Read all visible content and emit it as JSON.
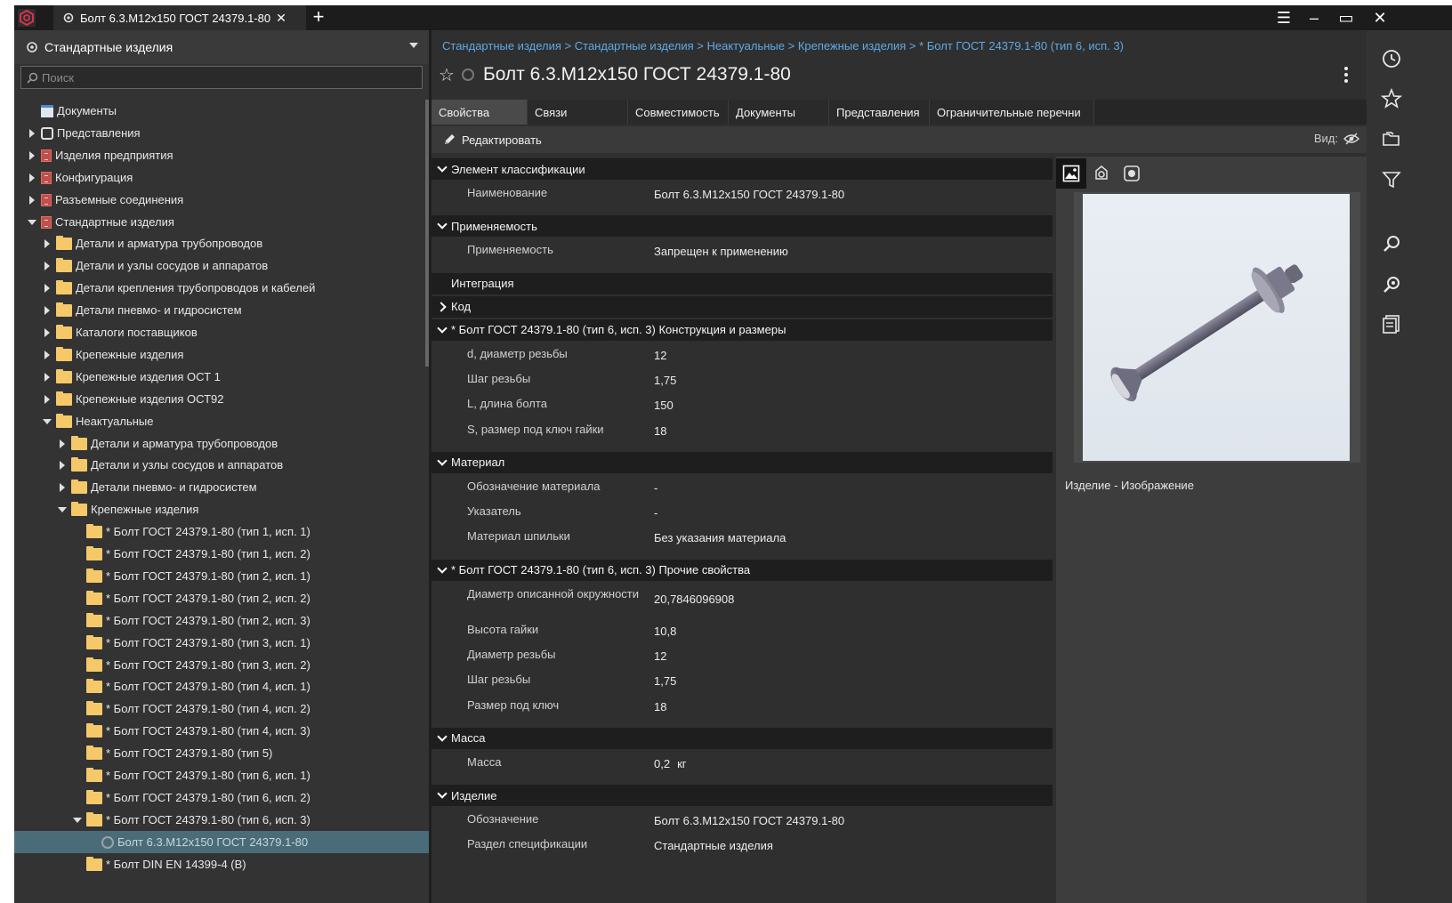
{
  "window": {
    "tab_title": "Болт 6.3.М12х150 ГОСТ 24379.1-80",
    "close_glyph": "✕",
    "new_tab_glyph": "+",
    "controls": {
      "menu": "☰",
      "minimize": "–",
      "maximize": "▭",
      "close": "✕"
    }
  },
  "left_panel": {
    "header_title": "Стандартные изделия",
    "search_placeholder": "Поиск",
    "tree": [
      {
        "label": "Документы",
        "level": 0,
        "expander": "none",
        "icon": "doc"
      },
      {
        "label": "Представления",
        "level": 0,
        "expander": "closed",
        "icon": "view"
      },
      {
        "label": "Изделия предприятия",
        "level": 0,
        "expander": "closed",
        "icon": "book"
      },
      {
        "label": "Конфигурация",
        "level": 0,
        "expander": "closed",
        "icon": "book"
      },
      {
        "label": "Разъемные соединения",
        "level": 0,
        "expander": "closed",
        "icon": "book"
      },
      {
        "label": "Стандартные изделия",
        "level": 0,
        "expander": "open",
        "icon": "book"
      },
      {
        "label": "Детали и арматура трубопроводов",
        "level": 1,
        "expander": "closed",
        "icon": "folder"
      },
      {
        "label": "Детали и узлы сосудов и аппаратов",
        "level": 1,
        "expander": "closed",
        "icon": "folder"
      },
      {
        "label": "Детали крепления трубопроводов и кабелей",
        "level": 1,
        "expander": "closed",
        "icon": "folder"
      },
      {
        "label": "Детали пневмо- и гидросистем",
        "level": 1,
        "expander": "closed",
        "icon": "folder"
      },
      {
        "label": "Каталоги поставщиков",
        "level": 1,
        "expander": "closed",
        "icon": "folder"
      },
      {
        "label": "Крепежные изделия",
        "level": 1,
        "expander": "closed",
        "icon": "folder"
      },
      {
        "label": "Крепежные изделия ОСТ 1",
        "level": 1,
        "expander": "closed",
        "icon": "folder"
      },
      {
        "label": "Крепежные изделия ОСТ92",
        "level": 1,
        "expander": "closed",
        "icon": "folder"
      },
      {
        "label": "Неактуальные",
        "level": 1,
        "expander": "open",
        "icon": "folder"
      },
      {
        "label": "Детали и арматура трубопроводов",
        "level": 2,
        "expander": "closed",
        "icon": "folder"
      },
      {
        "label": "Детали и узлы сосудов и аппаратов",
        "level": 2,
        "expander": "closed",
        "icon": "folder"
      },
      {
        "label": "Детали пневмо- и гидросистем",
        "level": 2,
        "expander": "closed",
        "icon": "folder"
      },
      {
        "label": "Крепежные изделия",
        "level": 2,
        "expander": "open",
        "icon": "folder"
      },
      {
        "label": "* Болт ГОСТ 24379.1-80 (тип 1, исп. 1)",
        "level": 3,
        "expander": "none",
        "icon": "folder"
      },
      {
        "label": "* Болт ГОСТ 24379.1-80 (тип 1, исп. 2)",
        "level": 3,
        "expander": "none",
        "icon": "folder"
      },
      {
        "label": "* Болт ГОСТ 24379.1-80 (тип 2, исп. 1)",
        "level": 3,
        "expander": "none",
        "icon": "folder"
      },
      {
        "label": "* Болт ГОСТ 24379.1-80 (тип 2, исп. 2)",
        "level": 3,
        "expander": "none",
        "icon": "folder"
      },
      {
        "label": "* Болт ГОСТ 24379.1-80 (тип 2, исп. 3)",
        "level": 3,
        "expander": "none",
        "icon": "folder"
      },
      {
        "label": "* Болт ГОСТ 24379.1-80 (тип 3, исп. 1)",
        "level": 3,
        "expander": "none",
        "icon": "folder"
      },
      {
        "label": "* Болт ГОСТ 24379.1-80 (тип 3, исп. 2)",
        "level": 3,
        "expander": "none",
        "icon": "folder"
      },
      {
        "label": "* Болт ГОСТ 24379.1-80 (тип 4, исп. 1)",
        "level": 3,
        "expander": "none",
        "icon": "folder"
      },
      {
        "label": "* Болт ГОСТ 24379.1-80 (тип 4, исп. 2)",
        "level": 3,
        "expander": "none",
        "icon": "folder"
      },
      {
        "label": "* Болт ГОСТ 24379.1-80 (тип 4, исп. 3)",
        "level": 3,
        "expander": "none",
        "icon": "folder"
      },
      {
        "label": "* Болт ГОСТ 24379.1-80 (тип 5)",
        "level": 3,
        "expander": "none",
        "icon": "folder"
      },
      {
        "label": "* Болт ГОСТ 24379.1-80 (тип 6, исп. 1)",
        "level": 3,
        "expander": "none",
        "icon": "folder"
      },
      {
        "label": "* Болт ГОСТ 24379.1-80 (тип 6, исп. 2)",
        "level": 3,
        "expander": "none",
        "icon": "folder"
      },
      {
        "label": "* Болт ГОСТ 24379.1-80 (тип 6, исп. 3)",
        "level": 3,
        "expander": "open",
        "icon": "folder"
      },
      {
        "label": "Болт 6.3.М12х150 ГОСТ 24379.1-80",
        "level": 4,
        "expander": "none",
        "icon": "gear",
        "selected": true
      },
      {
        "label": "* Болт DIN EN 14399-4 (B)",
        "level": 3,
        "expander": "none",
        "icon": "folder"
      }
    ]
  },
  "main": {
    "breadcrumb": [
      "Стандартные изделия",
      "Стандартные изделия",
      "Неактуальные",
      "Крепежные изделия",
      "* Болт ГОСТ 24379.1-80 (тип 6, исп. 3)"
    ],
    "breadcrumb_sep": ">",
    "star_glyph": "☆",
    "title": "Болт 6.3.М12х150 ГОСТ 24379.1-80",
    "tabs": [
      "Свойства",
      "Связи",
      "Совместимость",
      "Документы",
      "Представления",
      "Ограничительные перечни"
    ],
    "active_tab": 0,
    "edit_label": "Редактировать",
    "view_label": "Вид:",
    "sections": [
      {
        "title": "Элемент классификации",
        "state": "open",
        "rows": [
          {
            "key": "Наименование",
            "value": "Болт 6.3.М12х150 ГОСТ 24379.1-80"
          }
        ]
      },
      {
        "title": "Применяемость",
        "state": "open",
        "rows": [
          {
            "key": "Применяемость",
            "value": "Запрещен к применению"
          }
        ]
      },
      {
        "title": "Интеграция",
        "state": "plain",
        "rows": []
      },
      {
        "title": "Код",
        "state": "closed",
        "rows": []
      },
      {
        "title": "* Болт ГОСТ 24379.1-80 (тип 6, исп. 3) Конструкция и размеры",
        "state": "open",
        "rows": [
          {
            "key": "d, диаметр резьбы",
            "value": "12"
          },
          {
            "key": "Шаг резьбы",
            "value": "1,75"
          },
          {
            "key": "L, длина болта",
            "value": "150"
          },
          {
            "key": "S, размер под ключ гайки",
            "value": "18"
          }
        ]
      },
      {
        "title": "Материал",
        "state": "open",
        "rows": [
          {
            "key": "Обозначение материала",
            "value": "-"
          },
          {
            "key": "Указатель",
            "value": "-"
          },
          {
            "key": "Материал шпильки",
            "value": "Без указания материала"
          }
        ]
      },
      {
        "title": "* Болт ГОСТ 24379.1-80 (тип 6, исп. 3) Прочие свойства",
        "state": "open",
        "rows": [
          {
            "key": "Диаметр описанной окружности",
            "value": "20,7846096908"
          },
          {
            "key": "Высота гайки",
            "value": "10,8"
          },
          {
            "key": "Диаметр резьбы",
            "value": "12"
          },
          {
            "key": "Шаг резьбы",
            "value": "1,75"
          },
          {
            "key": "Размер под ключ",
            "value": "18"
          }
        ]
      },
      {
        "title": "Масса",
        "state": "open",
        "rows": [
          {
            "key": "Масса",
            "value": "0,2",
            "unit": "кг"
          }
        ]
      },
      {
        "title": "Изделие",
        "state": "open",
        "rows": [
          {
            "key": "Обозначение",
            "value": "Болт 6.3.М12х150 ГОСТ 24379.1-80"
          },
          {
            "key": "Раздел спецификации",
            "value": "Стандартные изделия"
          }
        ]
      }
    ],
    "preview_caption": "Изделие  -  Изображение"
  },
  "colors": {
    "accent_link": "#5fa9e6",
    "selection": "#4a6c78",
    "folder": "#f5c96a",
    "app_logo": "#d6334a"
  },
  "rail_icons": [
    "history-icon",
    "favorites-icon",
    "folders-icon",
    "filter-icon",
    "search-icon",
    "advanced-search-icon",
    "report-icon"
  ]
}
